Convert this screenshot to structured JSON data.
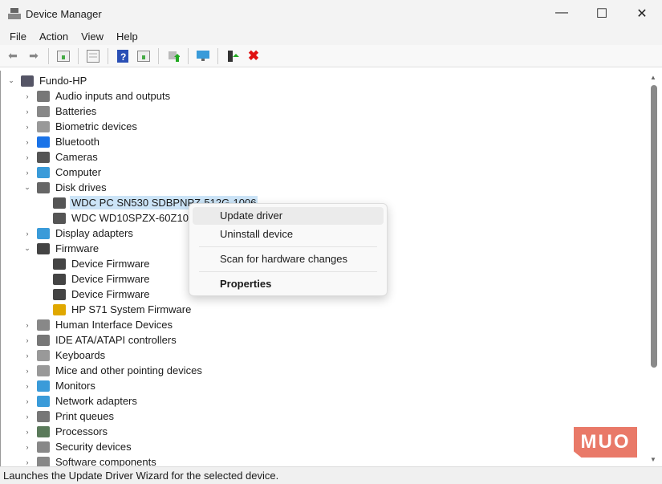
{
  "window": {
    "title": "Device Manager",
    "minimize": "—",
    "maximize": "☐",
    "close": "✕"
  },
  "menu": [
    "File",
    "Action",
    "View",
    "Help"
  ],
  "toolbar": [
    "back-icon",
    "forward-icon",
    "show-hide-console-tree-icon",
    "properties-icon",
    "help-icon",
    "action-pane-icon",
    "update-driver-icon",
    "scan-hardware-icon",
    "enable-device-icon",
    "uninstall-icon"
  ],
  "tree": [
    {
      "label": "Fundo-HP",
      "level": 0,
      "exp": "⌄",
      "color": "#556"
    },
    {
      "label": "Audio inputs and outputs",
      "level": 1,
      "exp": "›",
      "color": "#777"
    },
    {
      "label": "Batteries",
      "level": 1,
      "exp": "›",
      "color": "#888"
    },
    {
      "label": "Biometric devices",
      "level": 1,
      "exp": "›",
      "color": "#999"
    },
    {
      "label": "Bluetooth",
      "level": 1,
      "exp": "›",
      "color": "#1a73e8"
    },
    {
      "label": "Cameras",
      "level": 1,
      "exp": "›",
      "color": "#555"
    },
    {
      "label": "Computer",
      "level": 1,
      "exp": "›",
      "color": "#3a9bd9"
    },
    {
      "label": "Disk drives",
      "level": 1,
      "exp": "⌄",
      "color": "#666"
    },
    {
      "label": "WDC PC SN530 SDBPNPZ-512G-1006",
      "level": 2,
      "exp": "",
      "color": "#555",
      "selected": true
    },
    {
      "label": "WDC WD10SPZX-60Z10T0",
      "level": 2,
      "exp": "",
      "color": "#555"
    },
    {
      "label": "Display adapters",
      "level": 1,
      "exp": "›",
      "color": "#3a9bd9"
    },
    {
      "label": "Firmware",
      "level": 1,
      "exp": "⌄",
      "color": "#444"
    },
    {
      "label": "Device Firmware",
      "level": 2,
      "exp": "",
      "color": "#444"
    },
    {
      "label": "Device Firmware",
      "level": 2,
      "exp": "",
      "color": "#444"
    },
    {
      "label": "Device Firmware",
      "level": 2,
      "exp": "",
      "color": "#444"
    },
    {
      "label": "HP S71 System Firmware",
      "level": 2,
      "exp": "",
      "color": "#e0a800"
    },
    {
      "label": "Human Interface Devices",
      "level": 1,
      "exp": "›",
      "color": "#888"
    },
    {
      "label": "IDE ATA/ATAPI controllers",
      "level": 1,
      "exp": "›",
      "color": "#777"
    },
    {
      "label": "Keyboards",
      "level": 1,
      "exp": "›",
      "color": "#999"
    },
    {
      "label": "Mice and other pointing devices",
      "level": 1,
      "exp": "›",
      "color": "#999"
    },
    {
      "label": "Monitors",
      "level": 1,
      "exp": "›",
      "color": "#3a9bd9"
    },
    {
      "label": "Network adapters",
      "level": 1,
      "exp": "›",
      "color": "#3a9bd9"
    },
    {
      "label": "Print queues",
      "level": 1,
      "exp": "›",
      "color": "#777"
    },
    {
      "label": "Processors",
      "level": 1,
      "exp": "›",
      "color": "#5a7a5a"
    },
    {
      "label": "Security devices",
      "level": 1,
      "exp": "›",
      "color": "#888"
    },
    {
      "label": "Software components",
      "level": 1,
      "exp": "›",
      "color": "#888"
    }
  ],
  "context_menu": {
    "update": "Update driver",
    "uninstall": "Uninstall device",
    "scan": "Scan for hardware changes",
    "properties": "Properties"
  },
  "status": "Launches the Update Driver Wizard for the selected device.",
  "watermark": "MUO"
}
